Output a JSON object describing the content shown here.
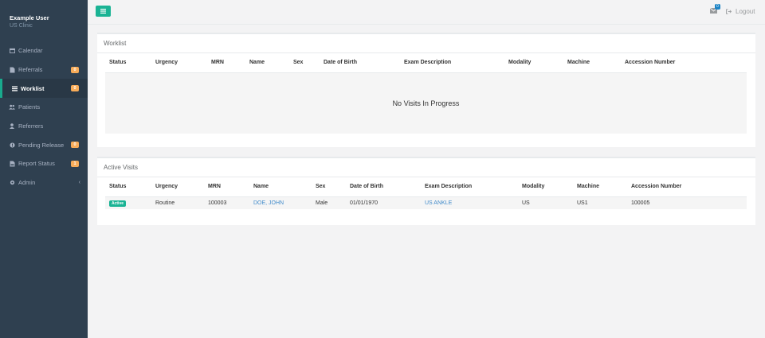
{
  "user": {
    "name": "Example User",
    "clinic": "US Clinic"
  },
  "nav": [
    {
      "label": "Calendar",
      "icon": "calendar-icon"
    },
    {
      "label": "Referrals",
      "icon": "file-icon",
      "badge": "0"
    },
    {
      "label": "Worklist",
      "icon": "list-icon",
      "badge": "0",
      "active": true
    },
    {
      "label": "Patients",
      "icon": "users-icon"
    },
    {
      "label": "Referrers",
      "icon": "user-icon"
    },
    {
      "label": "Pending Release",
      "icon": "circle-icon",
      "badge": "0"
    },
    {
      "label": "Report Status",
      "icon": "report-icon",
      "badge": "1"
    },
    {
      "label": "Admin",
      "icon": "cog-icon",
      "chevron": "‹"
    }
  ],
  "topbar": {
    "mail_count": "0",
    "logout_label": "Logout"
  },
  "worklist": {
    "title": "Worklist",
    "columns": [
      "Status",
      "Urgency",
      "MRN",
      "Name",
      "Sex",
      "Date of Birth",
      "Exam Description",
      "Modality",
      "Machine",
      "Accession Number"
    ],
    "empty_text": "No Visits In Progress"
  },
  "active_visits": {
    "title": "Active Visits",
    "columns": [
      "Status",
      "Urgency",
      "MRN",
      "Name",
      "Sex",
      "Date of Birth",
      "Exam Description",
      "Modality",
      "Machine",
      "Accession Number"
    ],
    "rows": [
      {
        "status": "Active",
        "urgency": "Routine",
        "mrn": "100003",
        "name": "DOE, JOHN",
        "sex": "Male",
        "dob": "01/01/1970",
        "exam": "US ANKLE",
        "modality": "US",
        "machine": "US1",
        "accession": "100005"
      }
    ]
  },
  "colors": {
    "sidebar": "#2f4050",
    "accent": "#1ab394",
    "badge": "#f8ac59",
    "link": "#428bca"
  }
}
